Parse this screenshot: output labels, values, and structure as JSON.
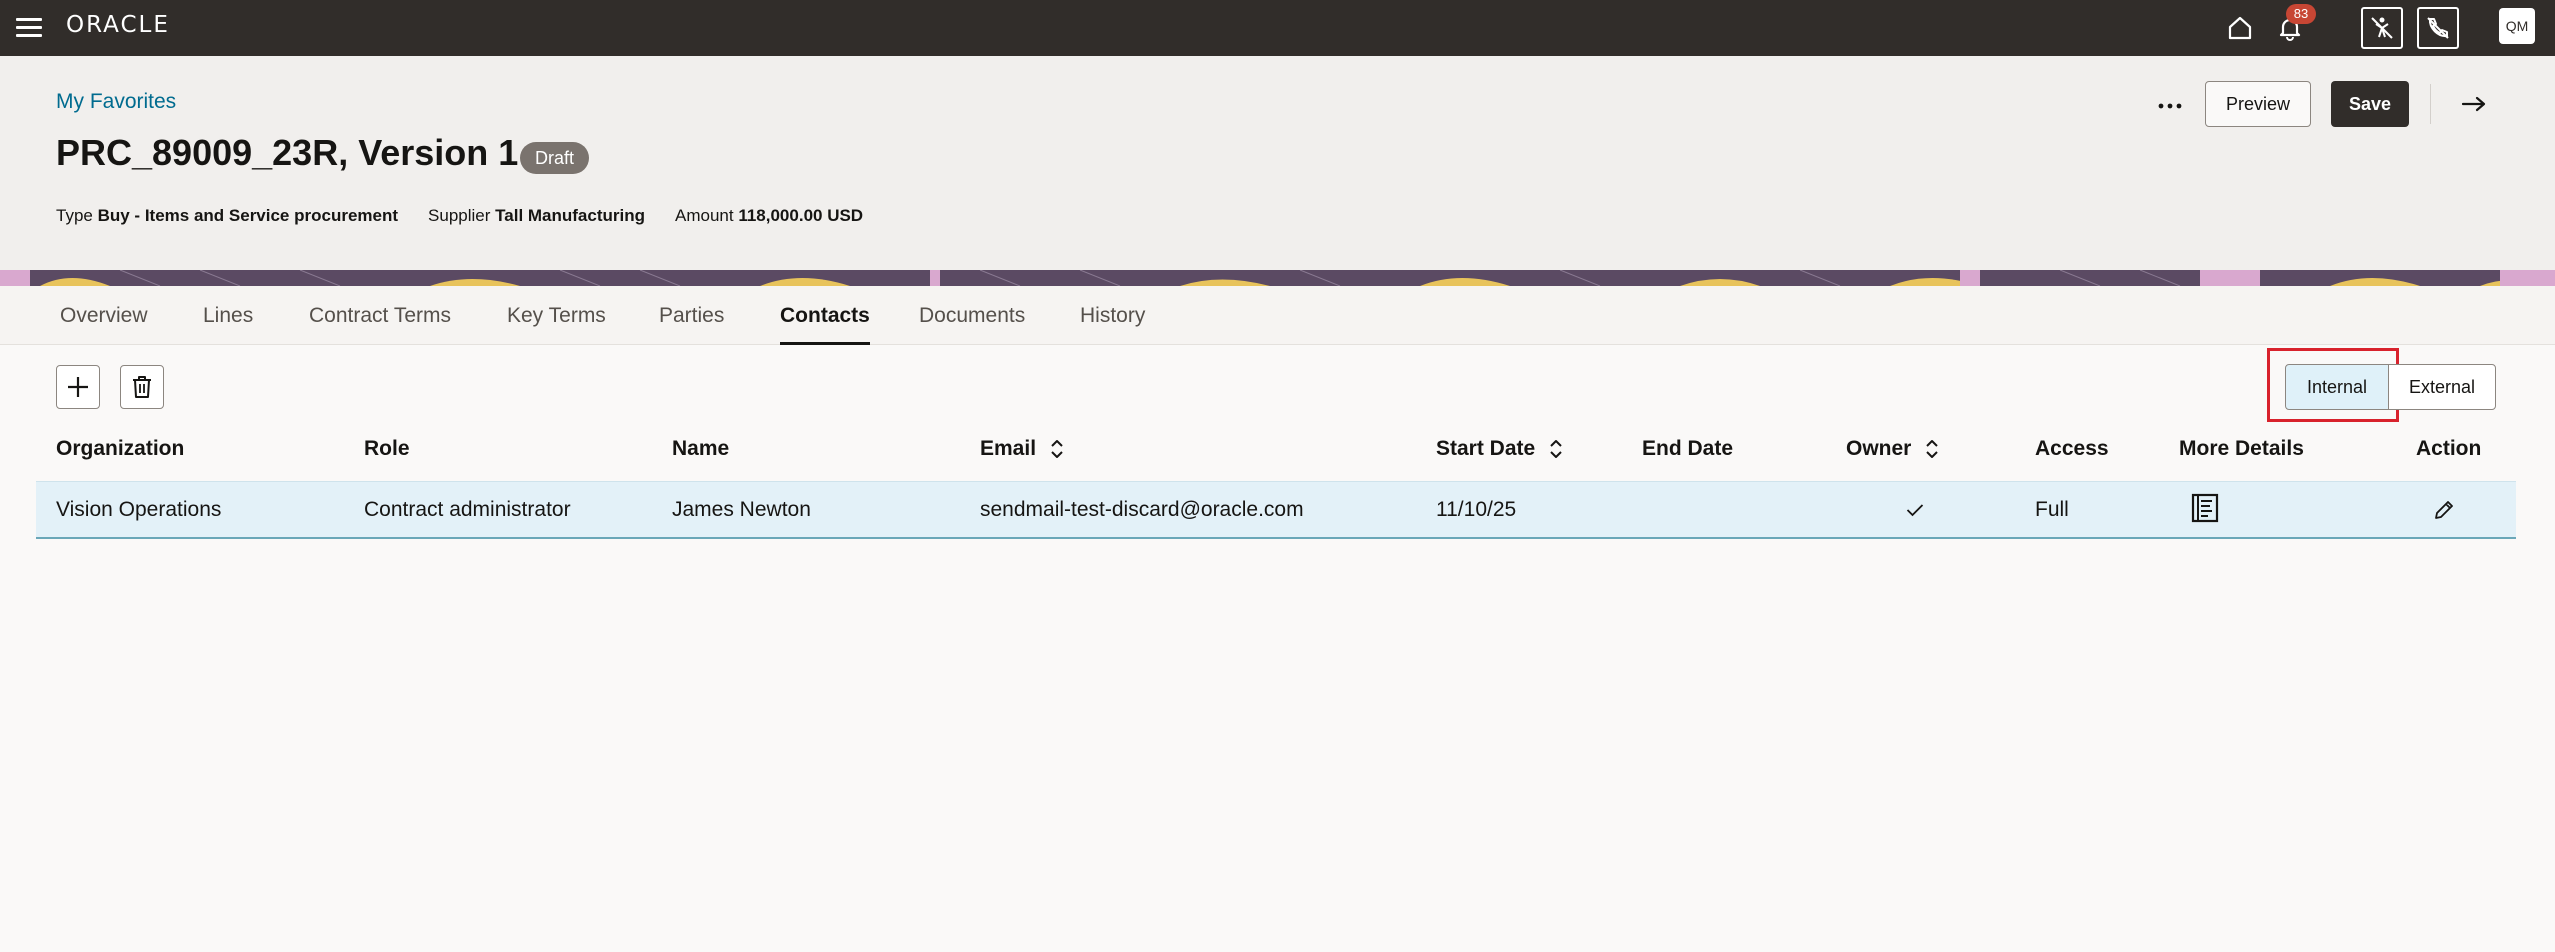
{
  "app": {
    "logo": "ORACLE",
    "notification_count": "83",
    "avatar_initials": "QM"
  },
  "header": {
    "breadcrumb": "My Favorites",
    "title": "PRC_89009_23R, Version 1",
    "status": "Draft",
    "meta": [
      {
        "label": "Type",
        "value": "Buy - Items and Service procurement"
      },
      {
        "label": "Supplier",
        "value": "Tall Manufacturing"
      },
      {
        "label": "Amount",
        "value": "118,000.00 USD"
      }
    ],
    "preview_label": "Preview",
    "save_label": "Save"
  },
  "tabs": [
    {
      "label": "Overview"
    },
    {
      "label": "Lines"
    },
    {
      "label": "Contract Terms"
    },
    {
      "label": "Key Terms"
    },
    {
      "label": "Parties"
    },
    {
      "label": "Contacts",
      "active": true
    },
    {
      "label": "Documents"
    },
    {
      "label": "History"
    }
  ],
  "toggle": {
    "internal": "Internal",
    "external": "External",
    "selected": "Internal"
  },
  "table": {
    "columns": [
      "Organization",
      "Role",
      "Name",
      "Email",
      "Start Date",
      "End Date",
      "Owner",
      "Access",
      "More Details",
      "Action"
    ],
    "rows": [
      {
        "organization": "Vision Operations",
        "role": "Contract administrator",
        "name": "James Newton",
        "email": "sendmail-test-discard@oracle.com",
        "start_date": "11/10/25",
        "end_date": "",
        "owner": true,
        "access": "Full"
      }
    ]
  },
  "colors": {
    "topbar": "#312d2a",
    "link": "#006b8f",
    "selected_row": "#e3f1f8",
    "highlight": "#d8222c"
  }
}
